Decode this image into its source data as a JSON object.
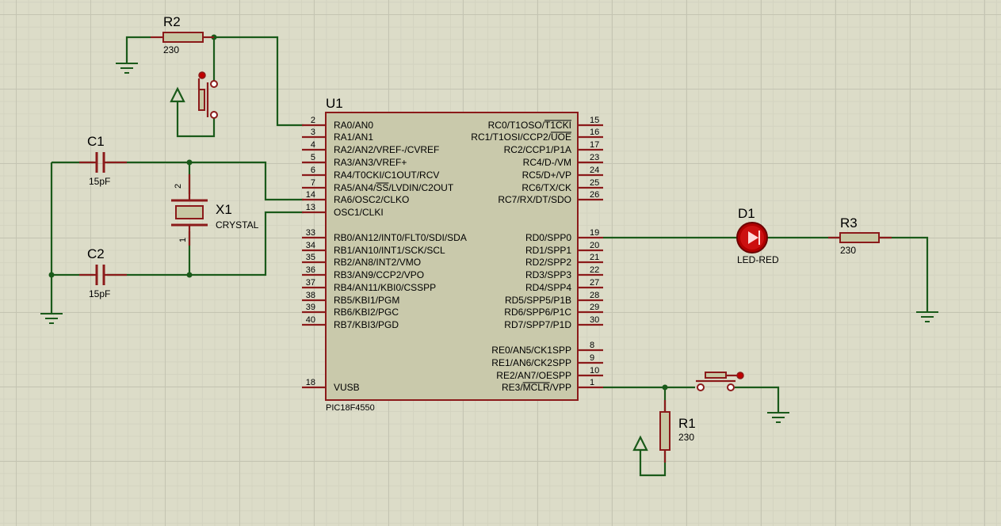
{
  "chip": {
    "ref": "U1",
    "part": "PIC18F4550",
    "left_pins": [
      {
        "num": "2",
        "name": "RA0/AN0"
      },
      {
        "num": "3",
        "name": "RA1/AN1"
      },
      {
        "num": "4",
        "name": "RA2/AN2/VREF-/CVREF"
      },
      {
        "num": "5",
        "name": "RA3/AN3/VREF+"
      },
      {
        "num": "6",
        "name": "RA4/T0CKI/C1OUT/RCV"
      },
      {
        "num": "7",
        "name": "RA5/AN4/SS/LVDIN/C2OUT"
      },
      {
        "num": "14",
        "name": "RA6/OSC2/CLKO"
      },
      {
        "num": "13",
        "name": "OSC1/CLKI"
      },
      {
        "num": "33",
        "name": "RB0/AN12/INT0/FLT0/SDI/SDA"
      },
      {
        "num": "34",
        "name": "RB1/AN10/INT1/SCK/SCL"
      },
      {
        "num": "35",
        "name": "RB2/AN8/INT2/VMO"
      },
      {
        "num": "36",
        "name": "RB3/AN9/CCP2/VPO"
      },
      {
        "num": "37",
        "name": "RB4/AN11/KBI0/CSSPP"
      },
      {
        "num": "38",
        "name": "RB5/KBI1/PGM"
      },
      {
        "num": "39",
        "name": "RB6/KBI2/PGC"
      },
      {
        "num": "40",
        "name": "RB7/KBI3/PGD"
      },
      {
        "num": "18",
        "name": "VUSB"
      }
    ],
    "right_pins": [
      {
        "num": "15",
        "name": "RC0/T1OSO/T1CKI"
      },
      {
        "num": "16",
        "name": "RC1/T1OSI/CCP2/UOE"
      },
      {
        "num": "17",
        "name": "RC2/CCP1/P1A"
      },
      {
        "num": "23",
        "name": "RC4/D-/VM"
      },
      {
        "num": "24",
        "name": "RC5/D+/VP"
      },
      {
        "num": "25",
        "name": "RC6/TX/CK"
      },
      {
        "num": "26",
        "name": "RC7/RX/DT/SDO"
      },
      {
        "num": "19",
        "name": "RD0/SPP0"
      },
      {
        "num": "20",
        "name": "RD1/SPP1"
      },
      {
        "num": "21",
        "name": "RD2/SPP2"
      },
      {
        "num": "22",
        "name": "RD3/SPP3"
      },
      {
        "num": "27",
        "name": "RD4/SPP4"
      },
      {
        "num": "28",
        "name": "RD5/SPP5/P1B"
      },
      {
        "num": "29",
        "name": "RD6/SPP6/P1C"
      },
      {
        "num": "30",
        "name": "RD7/SPP7/P1D"
      },
      {
        "num": "8",
        "name": "RE0/AN5/CK1SPP"
      },
      {
        "num": "9",
        "name": "RE1/AN6/CK2SPP"
      },
      {
        "num": "10",
        "name": "RE2/AN7/OESPP"
      },
      {
        "num": "1",
        "name": "RE3/MCLR/VPP"
      }
    ]
  },
  "components": {
    "r1": {
      "ref": "R1",
      "value": "230"
    },
    "r2": {
      "ref": "R2",
      "value": "230"
    },
    "r3": {
      "ref": "R3",
      "value": "230"
    },
    "c1": {
      "ref": "C1",
      "value": "15pF"
    },
    "c2": {
      "ref": "C2",
      "value": "15pF"
    },
    "x1": {
      "ref": "X1",
      "value": "CRYSTAL",
      "pin_top": "2",
      "pin_bottom": "1"
    },
    "d1": {
      "ref": "D1",
      "value": "LED-RED"
    }
  },
  "colors": {
    "wire": "#1a5a1a",
    "component_outline": "#8b1a1a",
    "component_fill": "#c8c8a4",
    "chip_fill": "#c9c9ab",
    "led_fill": "#b00000",
    "background": "#dcdcc8"
  }
}
